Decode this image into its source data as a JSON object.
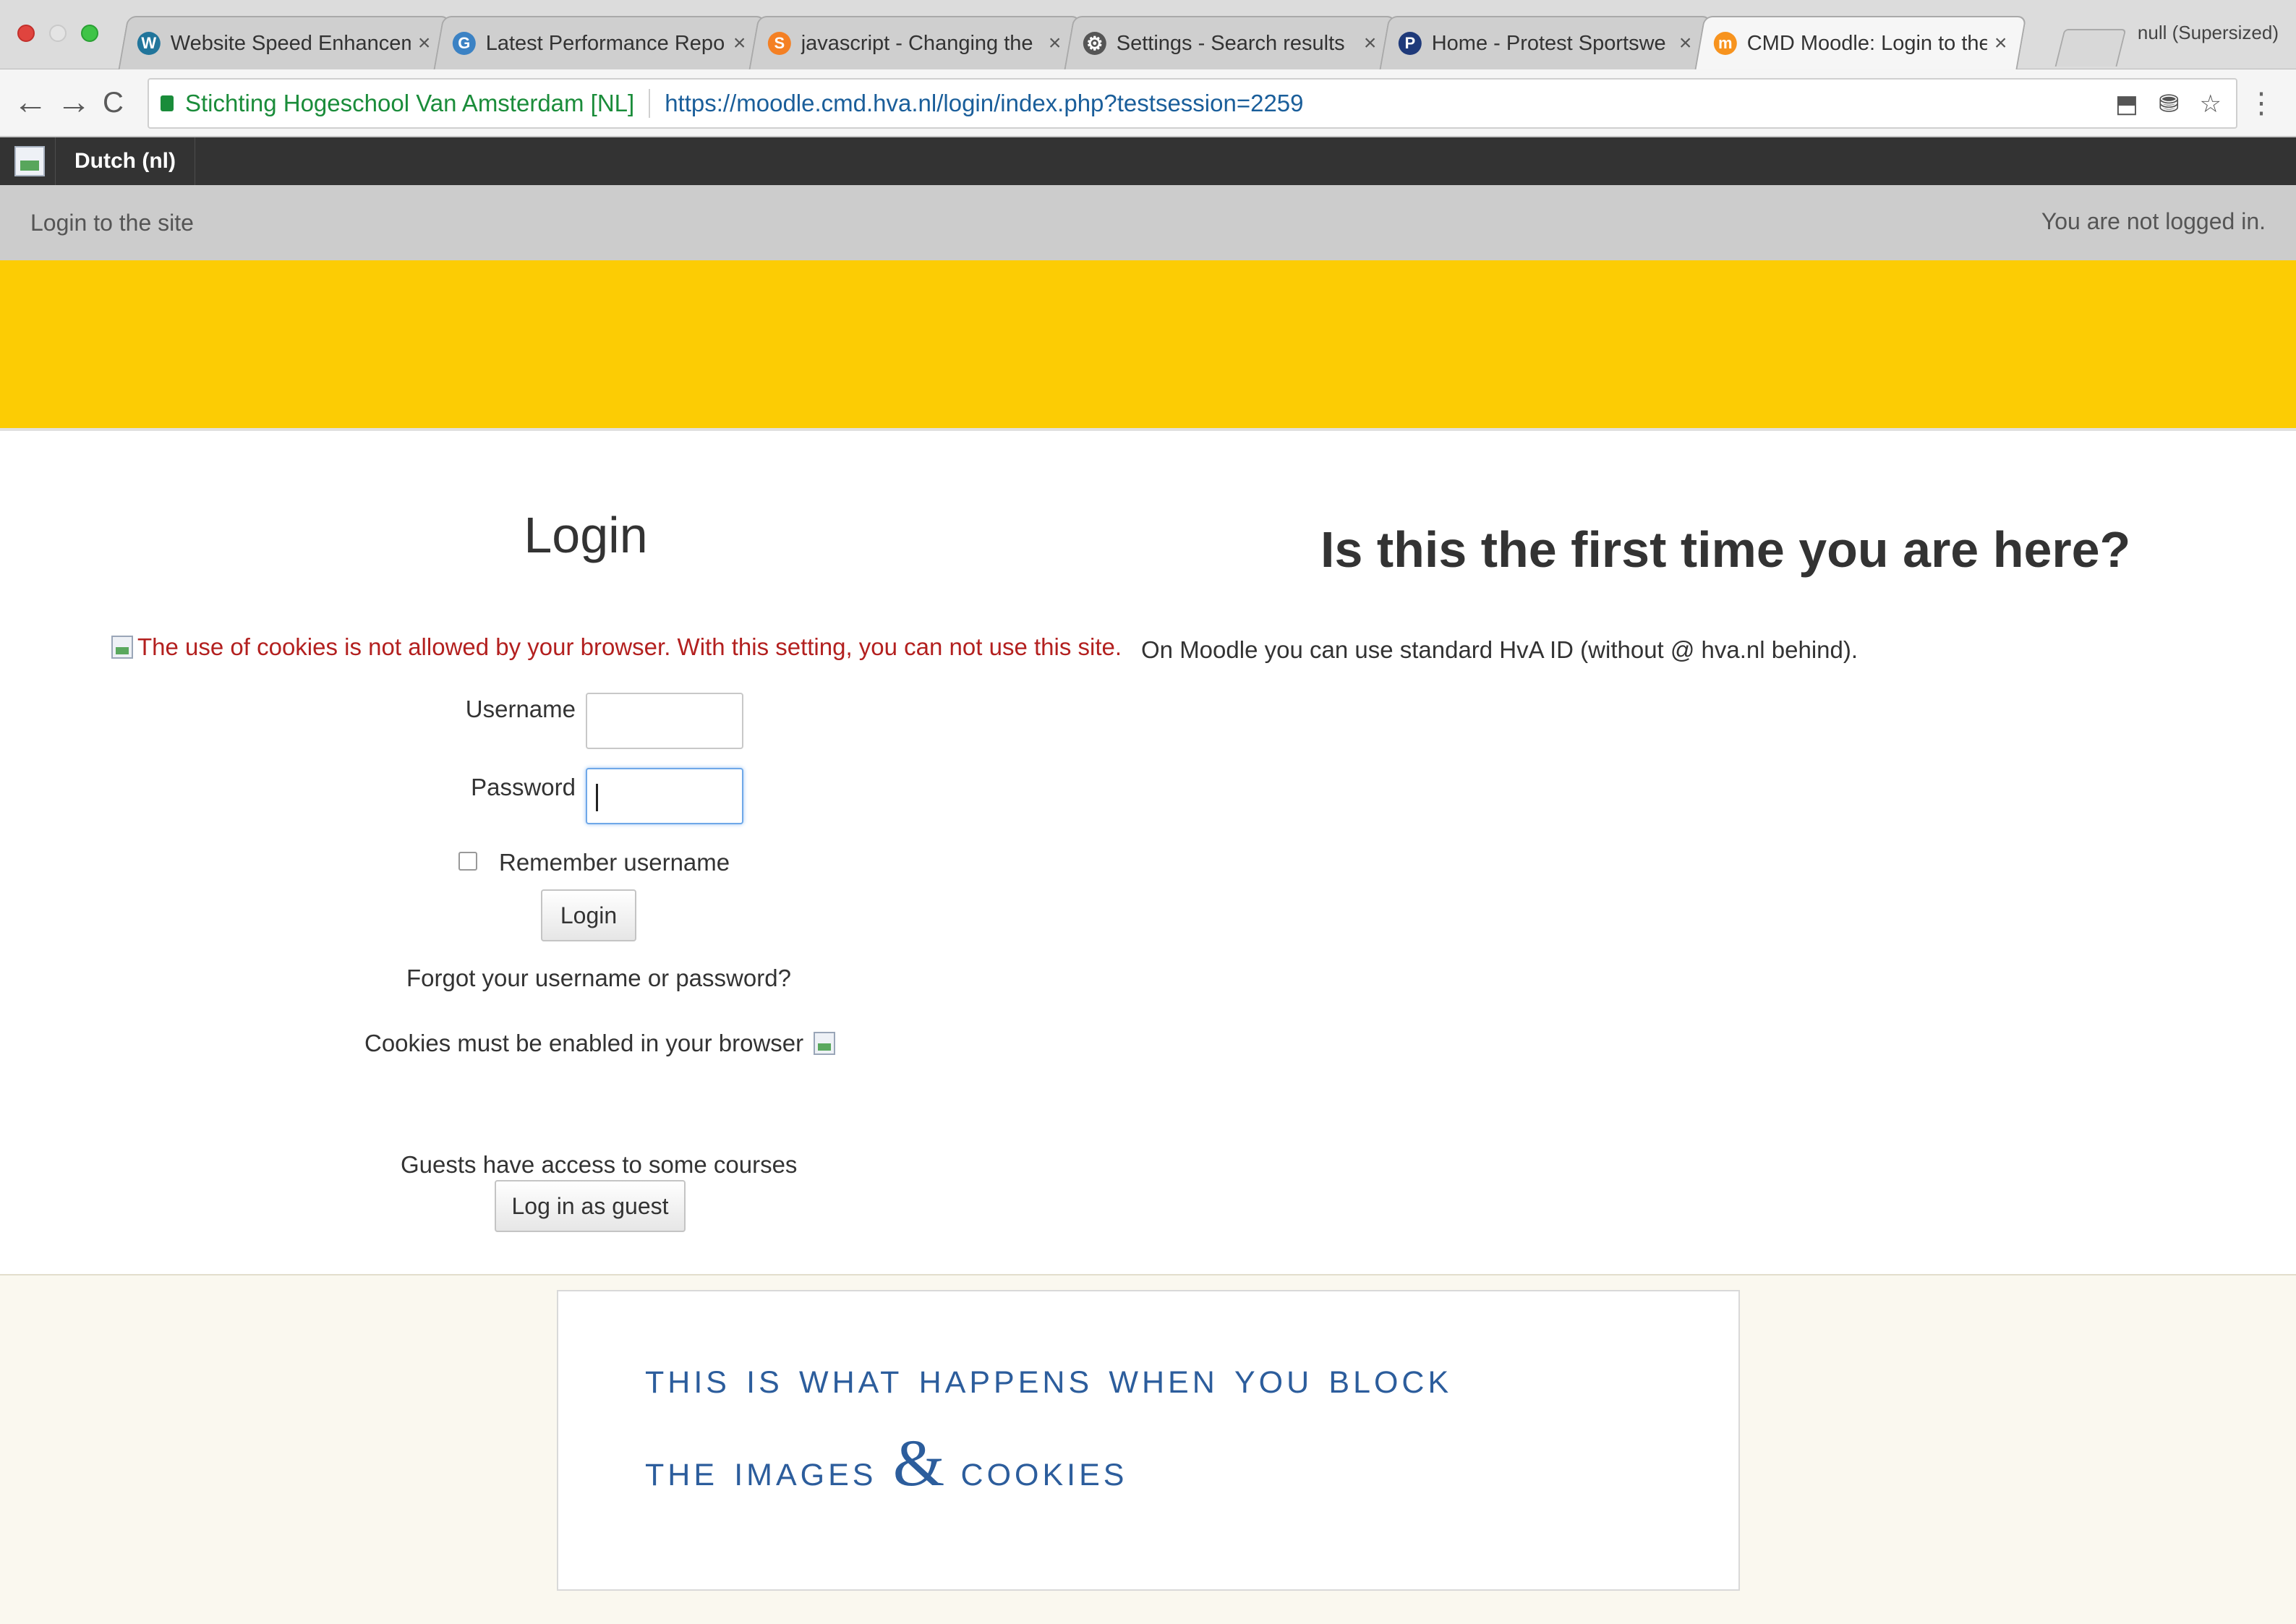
{
  "browser": {
    "tabs": [
      {
        "title": "Website Speed Enhancem",
        "icon": "wordpress-icon",
        "color": "#21759b",
        "active": false
      },
      {
        "title": "Latest Performance Repor",
        "icon": "gtmetrix-icon",
        "color": "#3b82c4",
        "active": false
      },
      {
        "title": "javascript - Changing the",
        "icon": "stackoverflow-icon",
        "color": "#f48024",
        "active": false
      },
      {
        "title": "Settings - Search results",
        "icon": "gear-icon",
        "color": "#555555",
        "active": false
      },
      {
        "title": "Home - Protest Sportswe",
        "icon": "p-logo-icon",
        "color": "#1f3a7a",
        "active": false
      },
      {
        "title": "CMD Moodle: Login to the",
        "icon": "moodle-icon",
        "color": "#f7931e",
        "active": true
      }
    ],
    "tab_close_glyph": "×",
    "profile_text": "null (Supersized)",
    "site_identity": "Stichting Hogeschool Van Amsterdam [NL]",
    "url": "https://moodle.cmd.hva.nl/login/index.php?testsession=2259",
    "nav": {
      "back": "←",
      "forward": "→",
      "reload": "C"
    },
    "actions": {
      "extension": "⬒",
      "cookies_blocked": "⛃",
      "bookmark": "☆"
    },
    "menu": "⋮"
  },
  "moodle": {
    "language": "Dutch (nl)",
    "breadcrumb": "Login to the site",
    "login_status": "You are not logged in.",
    "banner_color": "#fccc04",
    "login": {
      "heading": "Login",
      "cookie_error": "The use of cookies is not allowed by your browser. With this setting, you can not use this site.",
      "username_label": "Username",
      "username_value": "",
      "password_label": "Password",
      "password_value": "",
      "remember_label": "Remember username",
      "remember_checked": false,
      "login_button": "Login",
      "forgot_link": "Forgot your username or password?",
      "cookies_notice": "Cookies must be enabled in your browser",
      "guest_text": "Guests have access to some courses",
      "guest_button": "Log in as guest"
    },
    "first_time": {
      "heading": "Is this the first time you are here?",
      "text": "On Moodle you can use standard HvA ID (without @ hva.nl behind)."
    }
  },
  "caption": {
    "line1": "This is what happens when you block",
    "line2_before": "the images",
    "amp": "&",
    "line2_after": "cookies",
    "color": "#2c5d9c"
  }
}
